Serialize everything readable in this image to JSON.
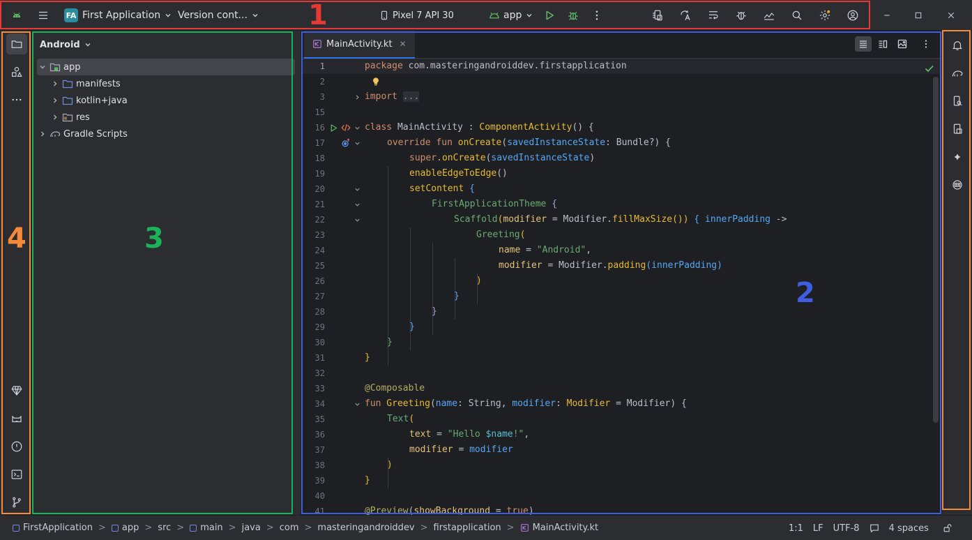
{
  "titlebar": {
    "project_badge": "FA",
    "project_name": "First Application",
    "vcs_label": "Version cont...",
    "device": "Pixel 7 API 30",
    "run_config": "app"
  },
  "window_controls": [
    "minimize",
    "maximize",
    "close"
  ],
  "project_panel": {
    "view_mode": "Android",
    "tree": [
      {
        "label": "app",
        "expanded": true,
        "selected": true
      },
      {
        "label": "manifests"
      },
      {
        "label": "kotlin+java"
      },
      {
        "label": "res"
      },
      {
        "label": "Gradle Scripts"
      }
    ]
  },
  "editor": {
    "tab_label": "MainActivity.kt",
    "tab_close": "✕",
    "lines": [
      {
        "n": "1"
      },
      {
        "n": "2"
      },
      {
        "n": "3"
      },
      {
        "n": "15"
      },
      {
        "n": "16"
      },
      {
        "n": "17"
      },
      {
        "n": "18"
      },
      {
        "n": "19"
      },
      {
        "n": "20"
      },
      {
        "n": "21"
      },
      {
        "n": "22"
      },
      {
        "n": "23"
      },
      {
        "n": "24"
      },
      {
        "n": "25"
      },
      {
        "n": "26"
      },
      {
        "n": "27"
      },
      {
        "n": "28"
      },
      {
        "n": "29"
      },
      {
        "n": "30"
      },
      {
        "n": "31"
      },
      {
        "n": "32"
      },
      {
        "n": "33"
      },
      {
        "n": "34"
      },
      {
        "n": "35"
      },
      {
        "n": "36"
      },
      {
        "n": "37"
      },
      {
        "n": "38"
      },
      {
        "n": "39"
      },
      {
        "n": "40"
      },
      {
        "n": "41"
      }
    ],
    "code": {
      "l1_kw": "package",
      "l1_rest": " com.masteringandroiddev.firstapplication",
      "l3_kw": "import",
      "l3_dots": "...",
      "l16_kw": "class",
      "l16_name": " MainActivity : ",
      "l16_type": "ComponentActivity",
      "l16_end": "() {",
      "l17_kw": "override fun",
      "l17_fn": " onCreate",
      "l17_par": "(",
      "l17_param": "savedInstanceState",
      "l17_end": ": Bundle?) {",
      "l18_kw": "super",
      "l18_fn": ".onCreate",
      "l18_open": "(",
      "l18_arg": "savedInstanceState",
      "l18_close": ")",
      "l19_fn": "enableEdgeToEdge",
      "l19_end": "()",
      "l20_fn": "setContent",
      "l20_end": " {",
      "l21_fn": "FirstApplicationTheme",
      "l21_end": " {",
      "l22_fn": "Scaffold",
      "l22_open": "(",
      "l22_param": "modifier",
      "l22_mid": " = Modifier.",
      "l22_fn2": "fillMaxSize",
      "l22_close": "()) ",
      "l22_brace": "{",
      "l22_lam": " innerPadding",
      "l22_arrow": " ->",
      "l23_fn": "Greeting",
      "l23_end": "(",
      "l24_param": "name",
      "l24_eq": " = ",
      "l24_str": "\"Android\"",
      "l24_end": ",",
      "l25_param": "modifier",
      "l25_mid": " = Modifier.",
      "l25_fn": "padding",
      "l25_open": "(",
      "l25_arg": "innerPadding",
      "l25_close": ")",
      "l26": ")",
      "l27": "}",
      "l28": "}",
      "l29": "}",
      "l30": "}",
      "l31": "}",
      "l33_ann": "@Composable",
      "l34_kw": "fun",
      "l34_fn": " Greeting",
      "l34_open": "(",
      "l34_p1": "name",
      "l34_t1": ": String, ",
      "l34_p2": "modifier",
      "l34_t2": ": ",
      "l34_type": "Modifier",
      "l34_end": " = Modifier) {",
      "l35_fn": "Text",
      "l35_end": "(",
      "l36_param": "text",
      "l36_eq": " = ",
      "l36_str1": "\"Hello ",
      "l36_tmpl": "$name",
      "l36_str2": "!\"",
      "l36_end": ",",
      "l37_param": "modifier",
      "l37_eq": " = ",
      "l37_val": "modifier",
      "l38": ")",
      "l39": "}",
      "l41_ann": "@Preview",
      "l41_open": "(",
      "l41_param": "showBackground",
      "l41_eq": " = ",
      "l41_val": "true",
      "l41_close": ")"
    }
  },
  "statusbar": {
    "breadcrumbs": [
      "FirstApplication",
      "app",
      "src",
      "main",
      "java",
      "com",
      "masteringandroiddev",
      "firstapplication",
      "MainActivity.kt"
    ],
    "separator": ">",
    "position": "1:1",
    "line_sep": "LF",
    "encoding": "UTF-8",
    "indent": "4 spaces"
  },
  "annotations": [
    {
      "label": "1",
      "color": "#e53935"
    },
    {
      "label": "2",
      "color": "#3f5de0"
    },
    {
      "label": "3",
      "color": "#1bb35a"
    },
    {
      "label": "4",
      "color": "#f58a3a"
    }
  ],
  "colors": {
    "accent": "#3574f0",
    "run_green": "#5fb865",
    "kotlin_purple": "#b07ad8"
  }
}
